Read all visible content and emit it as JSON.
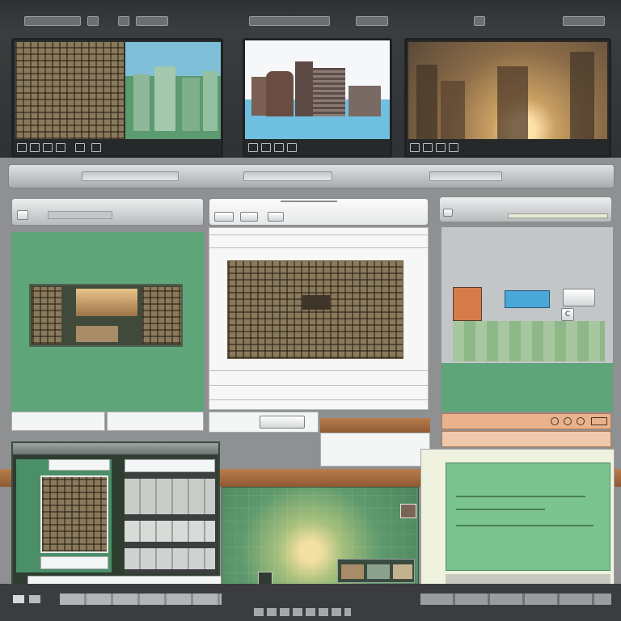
{
  "window": {
    "title": ""
  },
  "top_toolbar": {
    "button_count": 7
  },
  "monitors": [
    {
      "name": "monitor-city-grid",
      "caption": ""
    },
    {
      "name": "monitor-skyline",
      "caption": ""
    },
    {
      "name": "monitor-sunset-city",
      "caption": ""
    }
  ],
  "panels": {
    "left": {
      "label": ""
    },
    "center": {
      "label": ""
    },
    "right": {
      "label": "",
      "button_label": "C"
    }
  },
  "colors": {
    "panel_green": "#5ea57a",
    "dark_frame": "#2f3234",
    "chrome_light": "#eceeef",
    "accent_blue": "#4aa8d8",
    "brick": "#a86a3f"
  }
}
